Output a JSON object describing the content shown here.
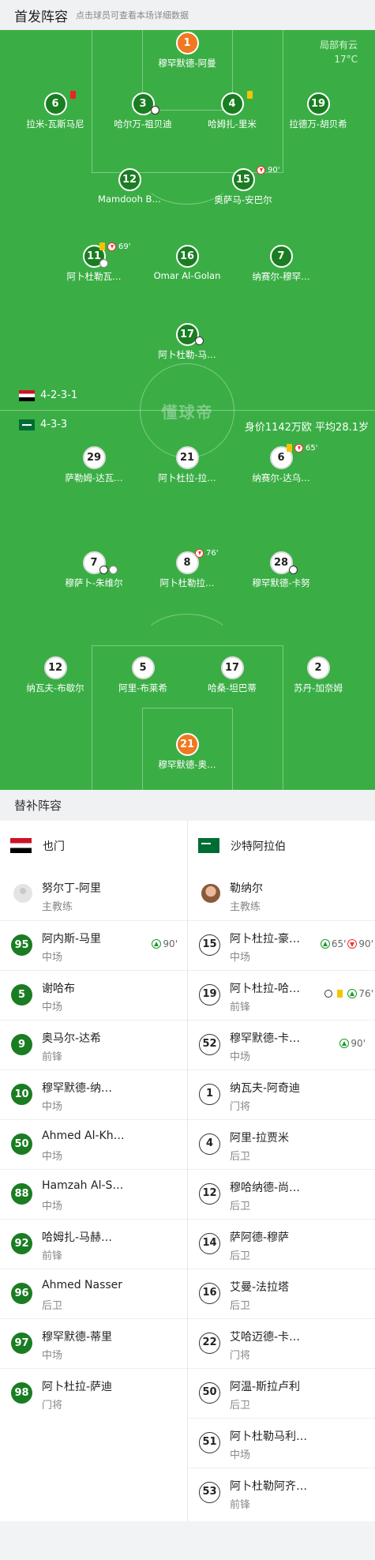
{
  "header": {
    "title": "首发阵容",
    "hint": "点击球员可查看本场详细数据"
  },
  "weather": {
    "condition": "局部有云",
    "temp": "17°C"
  },
  "watermark": "懂球帝",
  "home": {
    "formation": "4-2-3-1",
    "flag": "yemen-flag-icon",
    "players": [
      {
        "num": "1",
        "name": "穆罕默德-阿曼"
      },
      {
        "num": "6",
        "name": "拉米-瓦斯马尼"
      },
      {
        "num": "3",
        "name": "哈尔万-祖贝迪"
      },
      {
        "num": "4",
        "name": "哈姆扎-里米"
      },
      {
        "num": "19",
        "name": "拉德万-胡贝希"
      },
      {
        "num": "12",
        "name": "Mamdooh B…"
      },
      {
        "num": "15",
        "name": "奥萨马-安巴尔",
        "event": "90'"
      },
      {
        "num": "11",
        "name": "阿卜杜勒瓦…",
        "event": "69'"
      },
      {
        "num": "16",
        "name": "Omar Al-Golan"
      },
      {
        "num": "7",
        "name": "纳赛尔-穆罕…"
      },
      {
        "num": "17",
        "name": "阿卜杜勒-马…"
      }
    ]
  },
  "away": {
    "formation": "4-3-3",
    "flag": "saudi-flag-icon",
    "value_text": "身价1142万欧 平均28.1岁",
    "players": [
      {
        "num": "29",
        "name": "萨勒姆-达瓦…"
      },
      {
        "num": "21",
        "name": "阿卜杜拉-拉…"
      },
      {
        "num": "6",
        "name": "纳赛尔-达乌…",
        "event": "65'"
      },
      {
        "num": "7",
        "name": "穆萨卜-朱维尔"
      },
      {
        "num": "8",
        "name": "阿卜杜勒拉…",
        "event": "76'"
      },
      {
        "num": "28",
        "name": "穆罕默德-卡努"
      },
      {
        "num": "12",
        "name": "纳瓦夫-布歇尔"
      },
      {
        "num": "5",
        "name": "阿里-布莱希"
      },
      {
        "num": "17",
        "name": "哈桑-坦巴蒂"
      },
      {
        "num": "2",
        "name": "苏丹-加奈姆"
      },
      {
        "num": "21",
        "name": "穆罕默德-奥…"
      }
    ]
  },
  "bench": {
    "title": "替补阵容",
    "left": {
      "team": "也门",
      "coach": {
        "name": "努尔丁-阿里",
        "role": "主教练"
      },
      "players": [
        {
          "num": "95",
          "name": "阿内斯-马里",
          "pos": "中场",
          "ev": "90'"
        },
        {
          "num": "5",
          "name": "谢哈布",
          "pos": "中场"
        },
        {
          "num": "9",
          "name": "奥马尔-达希",
          "pos": "前锋"
        },
        {
          "num": "10",
          "name": "穆罕默德-纳…",
          "pos": "中场"
        },
        {
          "num": "50",
          "name": "Ahmed Al-Kh…",
          "pos": "中场"
        },
        {
          "num": "88",
          "name": "Hamzah Al-S…",
          "pos": "中场"
        },
        {
          "num": "92",
          "name": "哈姆扎-马赫…",
          "pos": "前锋"
        },
        {
          "num": "96",
          "name": "Ahmed Nasser",
          "pos": "后卫"
        },
        {
          "num": "97",
          "name": "穆罕默德-蒂里",
          "pos": "中场"
        },
        {
          "num": "98",
          "name": "阿卜杜拉-萨迪",
          "pos": "门将"
        }
      ]
    },
    "right": {
      "team": "沙特阿拉伯",
      "coach": {
        "name": "勒纳尔",
        "role": "主教练"
      },
      "players": [
        {
          "num": "15",
          "name": "阿卜杜拉-豪…",
          "pos": "中场",
          "ev1": "65'",
          "ev2": "90'"
        },
        {
          "num": "19",
          "name": "阿卜杜拉-哈…",
          "pos": "前锋",
          "ev1": "76'"
        },
        {
          "num": "52",
          "name": "穆罕默德-卡…",
          "pos": "中场",
          "ev1": "90'"
        },
        {
          "num": "1",
          "name": "纳瓦夫-阿奇迪",
          "pos": "门将"
        },
        {
          "num": "4",
          "name": "阿里-拉贾米",
          "pos": "后卫"
        },
        {
          "num": "12",
          "name": "穆哈纳德-尚…",
          "pos": "后卫"
        },
        {
          "num": "14",
          "name": "萨阿德-穆萨",
          "pos": "后卫"
        },
        {
          "num": "16",
          "name": "艾曼-法拉塔",
          "pos": "后卫"
        },
        {
          "num": "22",
          "name": "艾哈迈德-卡…",
          "pos": "门将"
        },
        {
          "num": "50",
          "name": "阿温-斯拉卢利",
          "pos": "后卫"
        },
        {
          "num": "51",
          "name": "阿卜杜勒马利…",
          "pos": "中场"
        },
        {
          "num": "53",
          "name": "阿卜杜勒阿齐…",
          "pos": "前锋"
        }
      ]
    }
  }
}
